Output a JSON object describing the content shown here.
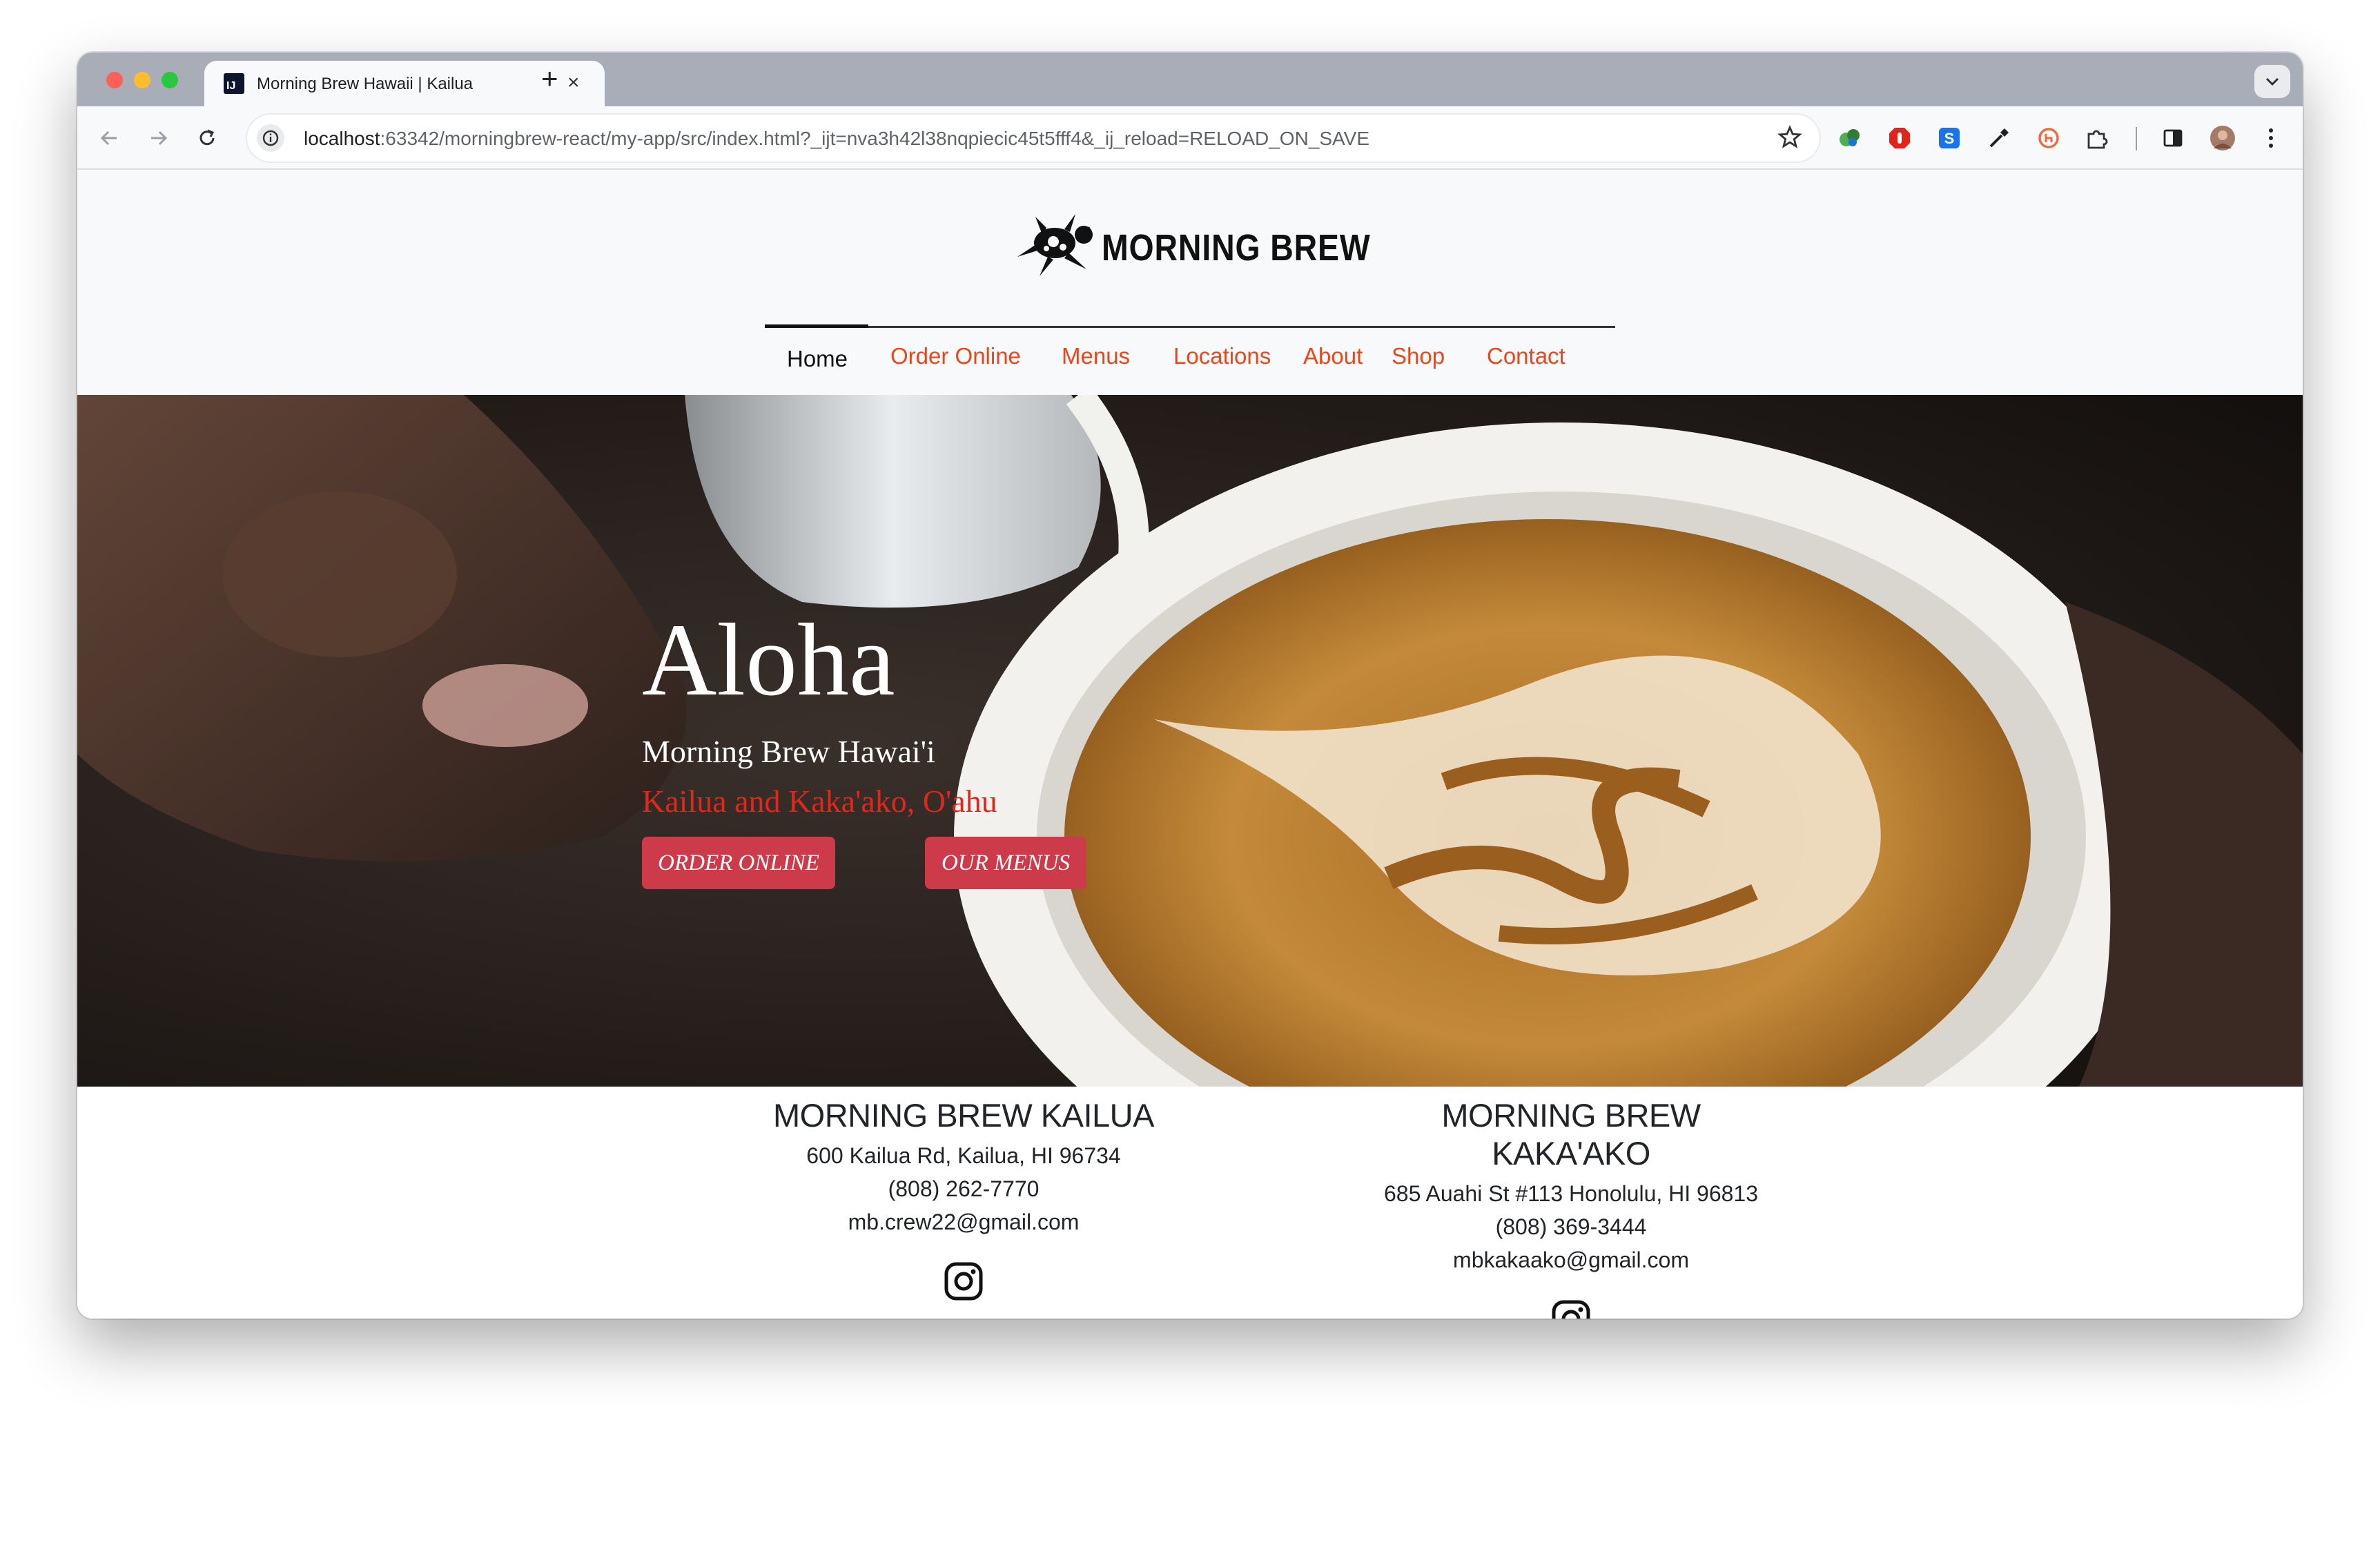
{
  "browser": {
    "tab_title": "Morning Brew Hawaii | Kailua",
    "tab_favicon": "IJ",
    "tab_close": "×",
    "new_tab": "+",
    "url_host": "localhost",
    "url_rest": ":63342/morningbrew-react/my-app/src/index.html?_ijt=nva3h42l38nqpiecic45t5fff4&_ij_reload=RELOAD_ON_SAVE",
    "icons": [
      "back-arrow-icon",
      "forward-arrow-icon",
      "reload-icon",
      "site-info-icon",
      "bookmark-star-icon",
      "puzzle-extension-icon",
      "side-panel-icon",
      "profile-avatar",
      "kebab-menu-icon"
    ]
  },
  "header": {
    "logo_text": "MORNING BREW",
    "nav": [
      {
        "label": "Home"
      },
      {
        "label": "Order Online"
      },
      {
        "label": "Menus"
      },
      {
        "label": "Locations"
      },
      {
        "label": "About"
      },
      {
        "label": "Shop"
      },
      {
        "label": "Contact"
      }
    ]
  },
  "hero": {
    "title": "Aloha",
    "subtitle": "Morning Brew Hawai'i",
    "locations": "Kailua and Kaka'ako, O'ahu",
    "buttons": {
      "order": "ORDER ONLINE",
      "menus": "OUR MENUS"
    }
  },
  "locations": [
    {
      "name": "MORNING BREW KAILUA",
      "address": "600 Kailua Rd, Kailua, HI 96734",
      "phone": "(808) 262-7770",
      "email": "mb.crew22@gmail.com"
    },
    {
      "name": "MORNING BREW KAKA'AKO",
      "address": "685 Auahi St #113 Honolulu, HI 96813",
      "phone": "(808) 369-3444",
      "email": "mbkakaako@gmail.com"
    }
  ],
  "colors": {
    "nav_link": "#e8461b",
    "button": "#cd3a4a",
    "hero_location": "#e1261c",
    "page_header_bg": "#f8f9fa"
  }
}
